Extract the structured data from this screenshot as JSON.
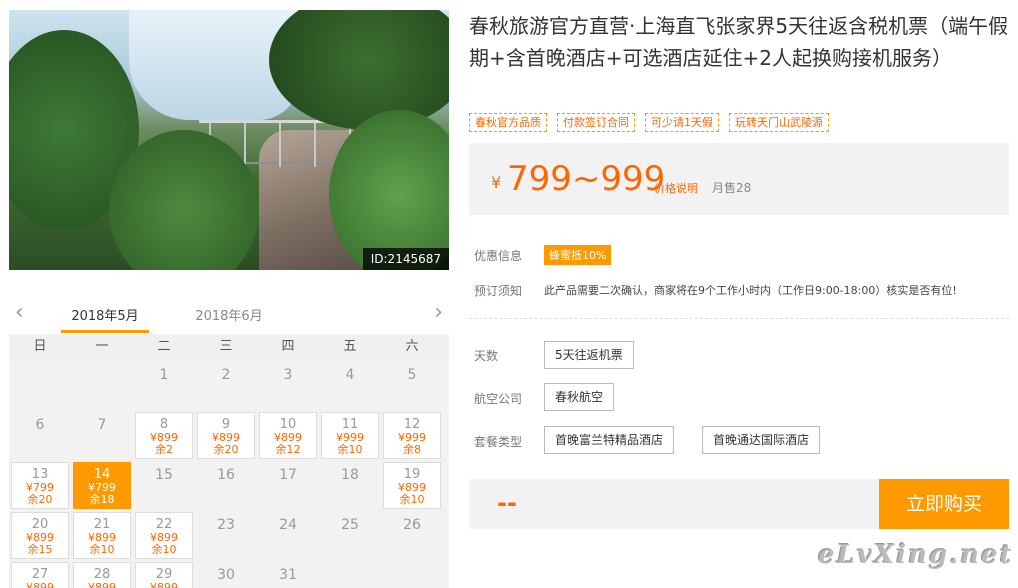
{
  "photo": {
    "id_label": "ID:2145687"
  },
  "calendar": {
    "prev_arrow": "‹",
    "next_arrow": "›",
    "tabs": [
      "2018年5月",
      "2018年6月"
    ],
    "weekdays": [
      "日",
      "一",
      "二",
      "三",
      "四",
      "五",
      "六"
    ],
    "days": [
      {
        "num": "1"
      },
      {
        "num": "2"
      },
      {
        "num": "3"
      },
      {
        "num": "4"
      },
      {
        "num": "5"
      },
      {
        "num": "6"
      },
      {
        "num": "7"
      },
      {
        "num": "8",
        "price": "¥899",
        "left": "余2"
      },
      {
        "num": "9",
        "price": "¥899",
        "left": "余20"
      },
      {
        "num": "10",
        "price": "¥899",
        "left": "余12"
      },
      {
        "num": "11",
        "price": "¥999",
        "left": "余10"
      },
      {
        "num": "12",
        "price": "¥999",
        "left": "余8"
      },
      {
        "num": "13",
        "price": "¥799",
        "left": "余20"
      },
      {
        "num": "14",
        "price": "¥799",
        "left": "余18"
      },
      {
        "num": "15"
      },
      {
        "num": "16"
      },
      {
        "num": "17"
      },
      {
        "num": "18"
      },
      {
        "num": "19",
        "price": "¥899",
        "left": "余10"
      },
      {
        "num": "20",
        "price": "¥899",
        "left": "余15"
      },
      {
        "num": "21",
        "price": "¥899",
        "left": "余10"
      },
      {
        "num": "22",
        "price": "¥899",
        "left": "余10"
      },
      {
        "num": "23"
      },
      {
        "num": "24"
      },
      {
        "num": "25"
      },
      {
        "num": "26"
      },
      {
        "num": "27",
        "price": "¥899"
      },
      {
        "num": "28",
        "price": "¥899"
      },
      {
        "num": "29",
        "price": "¥899"
      },
      {
        "num": "30"
      },
      {
        "num": "31"
      }
    ]
  },
  "product": {
    "title": "春秋旅游官方直营·上海直飞张家界5天往返含税机票（端午假期+含首晚酒店+可选酒店延住+2人起换购接机服务）",
    "tags": [
      "春秋官方品质",
      "付款签订合同",
      "可少请1天假",
      "玩转天门山武陵源"
    ],
    "price": {
      "currency": "¥",
      "amount": "799~999",
      "explain_link": "价格说明",
      "monthly_sales": "月售28"
    },
    "promo": {
      "label": "优惠信息",
      "badge": "蜂蜜抵10%"
    },
    "booking_notice": {
      "label": "预订须知",
      "text": "此产品需要二次确认，商家将在9个工作小时内（工作日9:00-18:00）核实是否有位!"
    },
    "options": {
      "days": {
        "label": "天数",
        "values": [
          "5天往返机票"
        ]
      },
      "airline": {
        "label": "航空公司",
        "values": [
          "春秋航空"
        ]
      },
      "package": {
        "label": "套餐类型",
        "values": [
          "首晚富兰特精品酒店",
          "首晚通达国际酒店"
        ]
      }
    },
    "total_placeholder": "--",
    "buy_button": "立即购买"
  },
  "watermark": "eLvXing.net",
  "colors": {
    "accent": "#ff9900",
    "price": "#ff6600"
  }
}
